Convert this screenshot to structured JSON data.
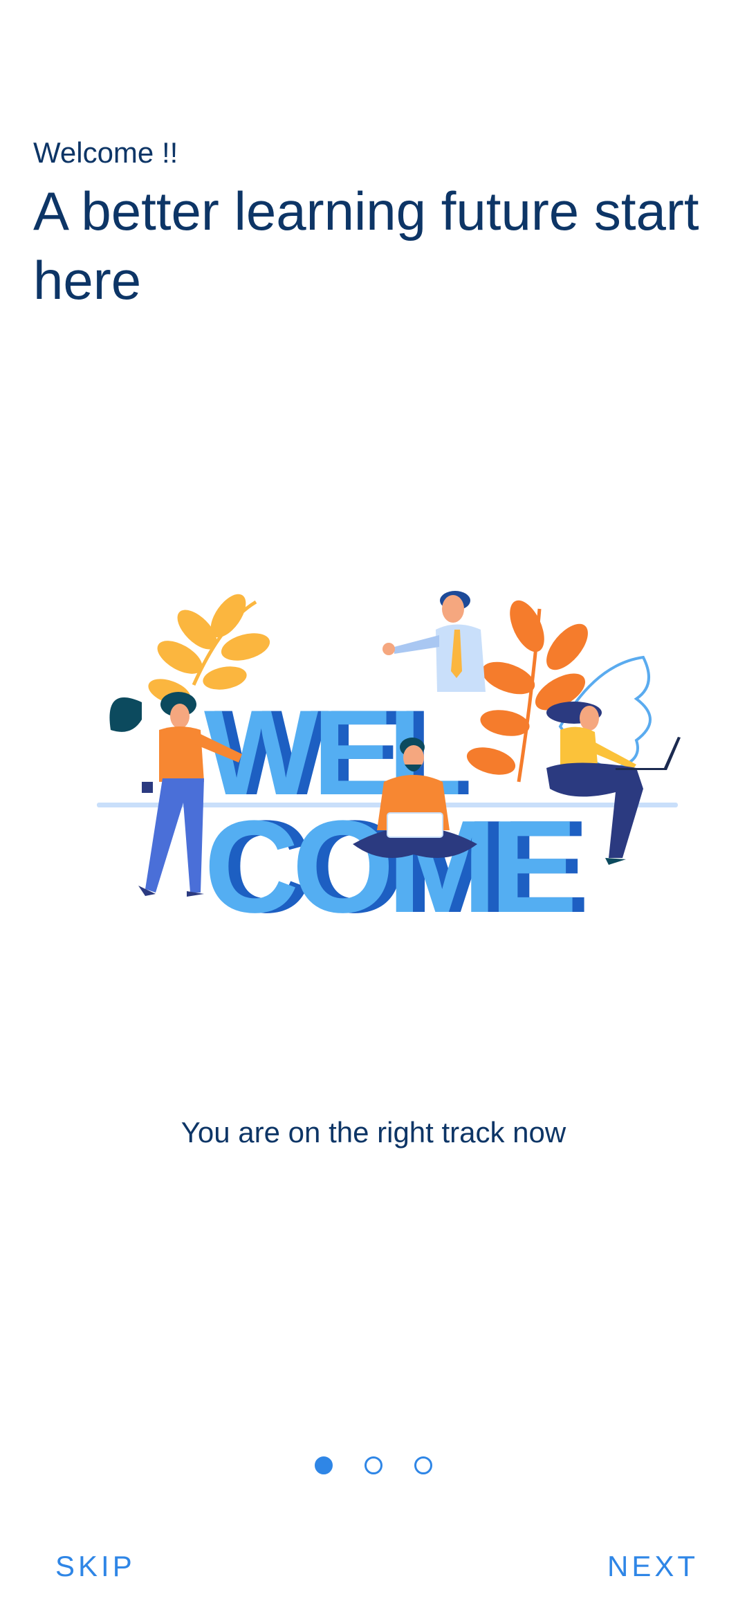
{
  "intro": {
    "greeting": "Welcome !!",
    "headline": "A better learning future start here"
  },
  "illustration": {
    "text_top": "WEL",
    "text_bottom": "COME"
  },
  "tagline": "You are on the right track now",
  "pager": {
    "total": 3,
    "current": 1
  },
  "nav": {
    "skip_label": "SKIP",
    "next_label": "NEXT"
  },
  "colors": {
    "text_primary": "#0d3566",
    "accent": "#2f86e6",
    "letter_light": "#54aef2",
    "letter_dark": "#1d5fc2",
    "leaf_yellow": "#fbb63f",
    "leaf_orange": "#f57c2c"
  }
}
